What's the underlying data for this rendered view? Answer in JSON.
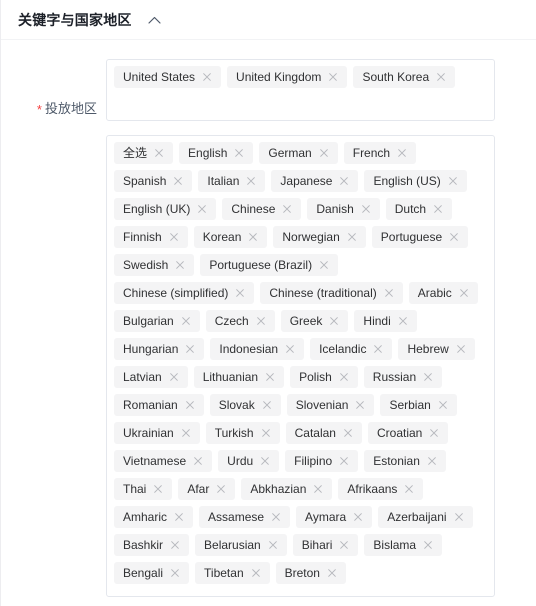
{
  "header": {
    "title": "关键字与国家地区",
    "collapse_icon": "chevron-up-icon"
  },
  "form": {
    "region": {
      "label": "投放地区",
      "required_mark": "*",
      "required": true,
      "tags": [
        "United States",
        "United Kingdom",
        "South Korea"
      ]
    },
    "languages": {
      "label": "",
      "required": false,
      "tags": [
        "全选",
        "English",
        "German",
        "French",
        "Spanish",
        "Italian",
        "Japanese",
        "English (US)",
        "English (UK)",
        "Chinese",
        "Danish",
        "Dutch",
        "Finnish",
        "Korean",
        "Norwegian",
        "Portuguese",
        "Swedish",
        "Portuguese (Brazil)",
        "Chinese (simplified)",
        "Chinese (traditional)",
        "Arabic",
        "Bulgarian",
        "Czech",
        "Greek",
        "Hindi",
        "Hungarian",
        "Indonesian",
        "Icelandic",
        "Hebrew",
        "Latvian",
        "Lithuanian",
        "Polish",
        "Russian",
        "Romanian",
        "Slovak",
        "Slovenian",
        "Serbian",
        "Ukrainian",
        "Turkish",
        "Catalan",
        "Croatian",
        "Vietnamese",
        "Urdu",
        "Filipino",
        "Estonian",
        "Thai",
        "Afar",
        "Abkhazian",
        "Afrikaans",
        "Amharic",
        "Assamese",
        "Aymara",
        "Azerbaijani",
        "Bashkir",
        "Belarusian",
        "Bihari",
        "Bislama",
        "Bengali",
        "Tibetan",
        "Breton"
      ]
    }
  },
  "icons": {
    "tag_close": "close-icon"
  },
  "colors": {
    "required_star": "#f53f3f",
    "tag_background": "#f4f4f5",
    "tag_text": "#303133",
    "border": "#e4e7ed",
    "title_text": "#1d2129",
    "label_text": "#4e5969"
  }
}
